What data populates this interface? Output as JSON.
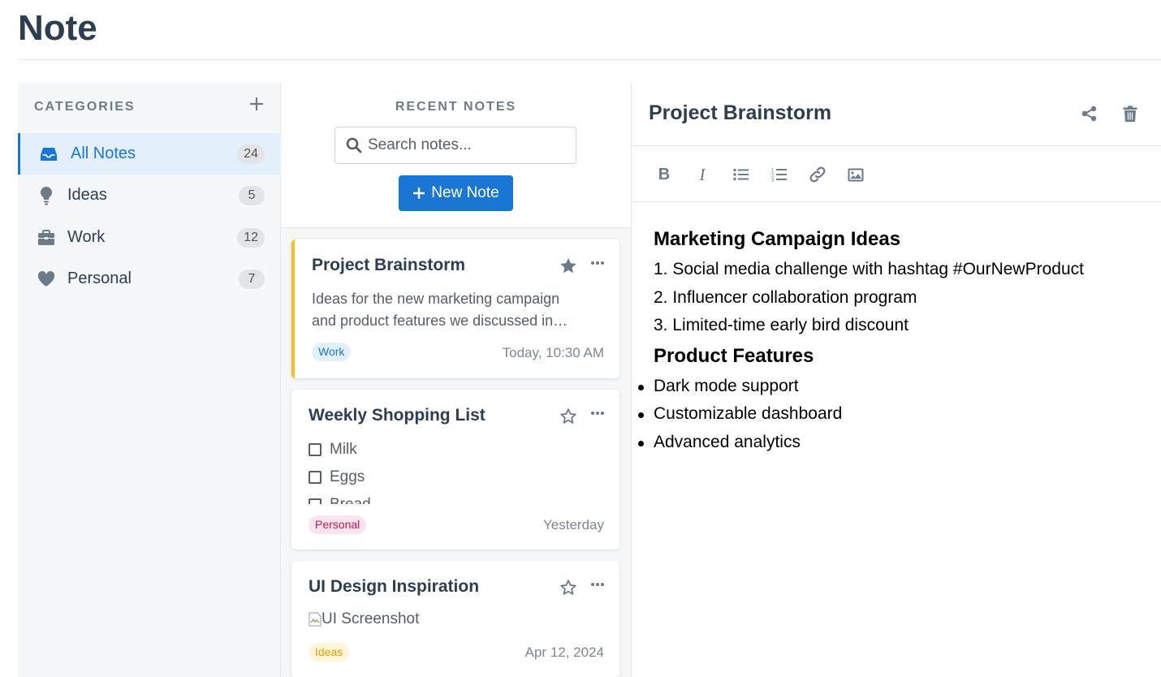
{
  "app": {
    "title": "Note"
  },
  "sidebar": {
    "header": "CATEGORIES",
    "items": [
      {
        "label": "All Notes",
        "count": "24",
        "icon": "inbox-icon",
        "active": true
      },
      {
        "label": "Ideas",
        "count": "5",
        "icon": "lightbulb-icon"
      },
      {
        "label": "Work",
        "count": "12",
        "icon": "briefcase-icon"
      },
      {
        "label": "Personal",
        "count": "7",
        "icon": "heart-icon"
      }
    ]
  },
  "notes": {
    "header": "RECENT NOTES",
    "search_placeholder": "Search notes...",
    "new_note_label": "New Note",
    "cards": [
      {
        "title": "Project Brainstorm",
        "preview_1": "Ideas for the new marketing campaign",
        "preview_2": "and product features we discussed in…",
        "tag": "Work",
        "date": "Today, 10:30 AM",
        "starred": true
      },
      {
        "title": "Weekly Shopping List",
        "checklist": [
          "Milk",
          "Eggs",
          "Bread"
        ],
        "tag": "Personal",
        "date": "Yesterday",
        "starred": false
      },
      {
        "title": "UI Design Inspiration",
        "image_alt": "UI Screenshot",
        "tag": "Ideas",
        "date": "Apr 12, 2024",
        "starred": false
      }
    ]
  },
  "editor": {
    "title": "Project Brainstorm",
    "heading_1": "Marketing Campaign Ideas",
    "ideas": [
      "1. Social media challenge with hashtag #OurNewProduct",
      "2. Influencer collaboration program",
      "3. Limited-time early bird discount"
    ],
    "heading_2": "Product Features",
    "features": [
      "Dark mode support",
      "Customizable dashboard",
      "Advanced analytics"
    ]
  },
  "colors": {
    "accent": "#1976d2",
    "selected_border": "#f6c026",
    "text": "#2c3e50",
    "muted": "#6b7b88"
  }
}
